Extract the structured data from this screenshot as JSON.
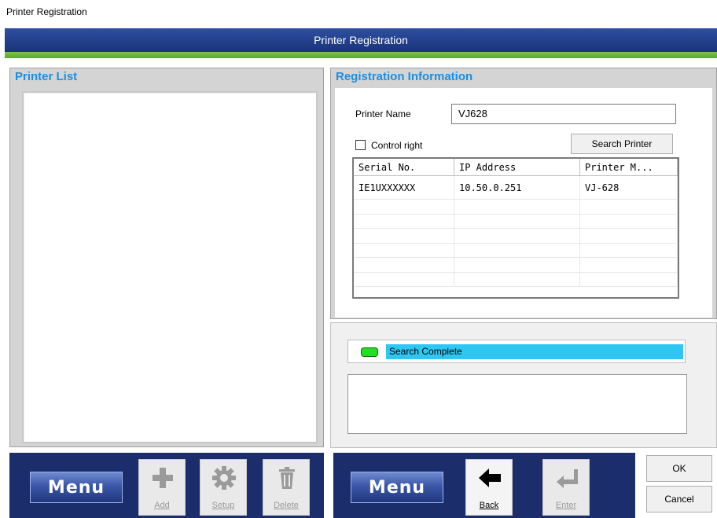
{
  "window": {
    "title": "Printer Registration"
  },
  "banner": {
    "title": "Printer Registration"
  },
  "printer_list": {
    "header": "Printer List"
  },
  "registration": {
    "header": "Registration Information",
    "printer_name_label": "Printer Name",
    "printer_name_value": "VJ628",
    "control_right_label": "Control right",
    "control_right_checked": false,
    "search_button": "Search Printer",
    "columns": [
      "Serial No.",
      "IP Address",
      "Printer M..."
    ],
    "rows": [
      {
        "serial": "IE1UXXXXXX",
        "ip": "10.50.0.251",
        "model": "VJ-628"
      }
    ]
  },
  "status": {
    "text": "Search Complete",
    "led_color": "#22e022",
    "bar_color": "#2ec7f3"
  },
  "left_toolbar": {
    "menu_label": "Menu",
    "buttons": [
      {
        "label": "Add",
        "icon": "plus-icon",
        "enabled": false
      },
      {
        "label": "Setup",
        "icon": "gear-icon",
        "enabled": false
      },
      {
        "label": "Delete",
        "icon": "trash-icon",
        "enabled": false
      }
    ]
  },
  "right_toolbar": {
    "menu_label": "Menu",
    "buttons": [
      {
        "label": "Back",
        "icon": "arrow-left-icon",
        "enabled": true
      },
      {
        "label": "Enter",
        "icon": "enter-arrow-icon",
        "enabled": false
      }
    ]
  },
  "dialog_buttons": {
    "ok": "OK",
    "cancel": "Cancel"
  },
  "colors": {
    "header_blue": "#1a8fe6",
    "navy": "#1c2d6b",
    "accent_green": "#6bb83a"
  }
}
